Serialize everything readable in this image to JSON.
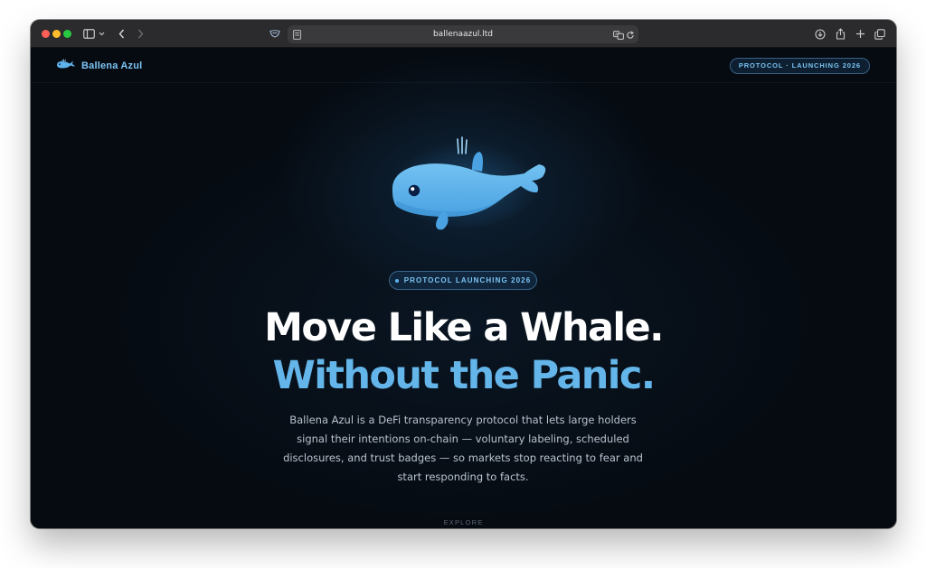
{
  "browser": {
    "url": "ballenaazul.ltd"
  },
  "nav": {
    "brand_name": "Ballena Azul",
    "badge": "PROTOCOL · LAUNCHING 2026"
  },
  "hero": {
    "badge": "PROTOCOL LAUNCHING 2026",
    "title_line1": "Move Like a Whale.",
    "title_line2": "Without the Panic.",
    "description": "Ballena Azul is a DeFi transparency protocol that lets large holders signal their intentions on-chain — voluntary labeling, scheduled disclosures, and trust badges — so markets stop reacting to fear and start responding to facts.",
    "explore_label": "EXPLORE"
  },
  "colors": {
    "accent": "#64b5ea",
    "page_background": "#060b12",
    "heading": "#ffffff",
    "body_text": "#b9c3cf"
  },
  "icons": {
    "toolbar_left": [
      "sidebar-icon",
      "chevron-down-icon",
      "back-icon",
      "forward-icon",
      "shield-icon",
      "page-icon"
    ],
    "toolbar_right": [
      "translate-icon",
      "reload-icon",
      "download-icon",
      "share-icon",
      "new-tab-icon",
      "tabs-overview-icon"
    ],
    "brand": "whale-icon",
    "hero_illustration": "whale-illustration",
    "explore": "chevron-down-icon"
  }
}
